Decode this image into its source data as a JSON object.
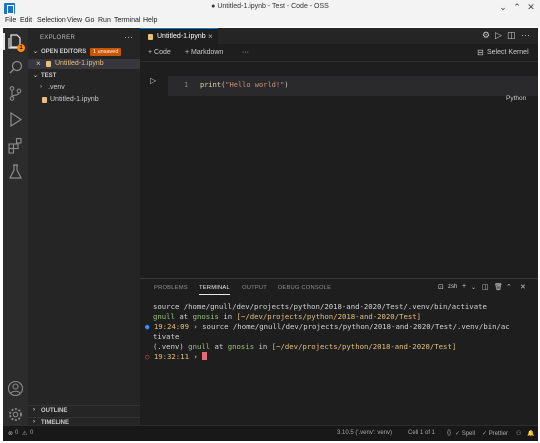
{
  "window": {
    "title": "● Untitled-1.ipynb - Test - Code - OSS",
    "controls": [
      "chevron-down-icon",
      "chevron-up-icon",
      "close-icon"
    ]
  },
  "menu": [
    "File",
    "Edit",
    "Selection",
    "View",
    "Go",
    "Run",
    "Terminal",
    "Help"
  ],
  "activity_bar": {
    "items": [
      "files-icon",
      "search-icon",
      "source-control-icon",
      "run-debug-icon",
      "extensions-icon",
      "testing-icon"
    ],
    "badge": "1",
    "bottom": [
      "account-icon",
      "settings-gear-icon"
    ]
  },
  "explorer": {
    "header": "EXPLORER",
    "open_editors": {
      "label": "OPEN EDITORS",
      "badge": "1 unsaved",
      "items": [
        "Untitled-1.ipynb"
      ]
    },
    "workspace": {
      "label": "TEST",
      "items": [
        ".venv",
        "Untitled-1.ipynb"
      ]
    },
    "outline": "OUTLINE",
    "timeline": "TIMELINE"
  },
  "editor": {
    "tab": "Untitled-1.ipynb",
    "toolbar": {
      "add_code": "+ Code",
      "add_markdown": "+ Markdown",
      "more": "···",
      "kernel": "Select Kernel"
    },
    "cell": {
      "line_number": "1",
      "fn": "print",
      "arg": "\"Hello world!\"",
      "language": "Python"
    }
  },
  "panel": {
    "tabs": [
      "PROBLEMS",
      "TERMINAL",
      "OUTPUT",
      "DEBUG CONSOLE"
    ],
    "active_tab": "TERMINAL",
    "shell": "zsh",
    "terminal": {
      "line1": "source /home/gnull/dev/projects/python/2018-and-2020/Test/.venv/bin/activate",
      "line2_user": "gnull",
      "line2_at": "at",
      "line2_host": "gnosis",
      "line2_in": "in",
      "line2_path": "[~/dev/projects/python/2018-and-2020/Test]",
      "line3_time": "19:24:09",
      "line3_cmd": "› source /home/gnull/dev/projects/python/2018-and-2020/Test/.venv/bin/ac",
      "line4": "tivate",
      "line5_venv": "(.venv)",
      "line5_user": "gnull",
      "line5_at": "at",
      "line5_host": "gnosis",
      "line5_in": "in",
      "line5_path": "[~/dev/projects/python/2018-and-2020/Test]",
      "line6_time": "19:32:11",
      "line6_prompt": "›"
    }
  },
  "status": {
    "errors": "0",
    "warnings": "0",
    "python": "3.10.5 ('.venv': venv)",
    "cell": "Cell 1 of 1",
    "spell": "✓ Spell",
    "prettier": "✓ Prettier"
  }
}
